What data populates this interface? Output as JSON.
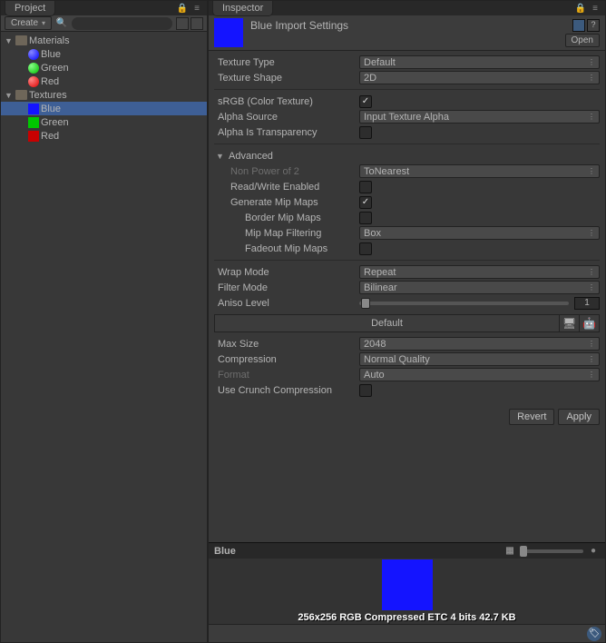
{
  "project": {
    "tab": "Project",
    "create_label": "Create",
    "tree": {
      "materials": "Materials",
      "blue": "Blue",
      "green": "Green",
      "red": "Red",
      "textures": "Textures"
    }
  },
  "inspector": {
    "tab": "Inspector",
    "title": "Blue Import Settings",
    "open": "Open",
    "texture_type_label": "Texture Type",
    "texture_type_value": "Default",
    "texture_shape_label": "Texture Shape",
    "texture_shape_value": "2D",
    "srgb_label": "sRGB (Color Texture)",
    "alpha_source_label": "Alpha Source",
    "alpha_source_value": "Input Texture Alpha",
    "alpha_transparency_label": "Alpha Is Transparency",
    "advanced_label": "Advanced",
    "npot_label": "Non Power of 2",
    "npot_value": "ToNearest",
    "rw_label": "Read/Write Enabled",
    "mipmaps_label": "Generate Mip Maps",
    "border_mip_label": "Border Mip Maps",
    "mip_filter_label": "Mip Map Filtering",
    "mip_filter_value": "Box",
    "fadeout_label": "Fadeout Mip Maps",
    "wrap_label": "Wrap Mode",
    "wrap_value": "Repeat",
    "filter_label": "Filter Mode",
    "filter_value": "Bilinear",
    "aniso_label": "Aniso Level",
    "aniso_value": "1",
    "platform_default": "Default",
    "max_size_label": "Max Size",
    "max_size_value": "2048",
    "compression_label": "Compression",
    "compression_value": "Normal Quality",
    "format_label": "Format",
    "format_value": "Auto",
    "crunch_label": "Use Crunch Compression",
    "revert": "Revert",
    "apply": "Apply",
    "preview_name": "Blue",
    "preview_caption": "256x256  RGB Compressed ETC 4 bits   42.7 KB"
  }
}
